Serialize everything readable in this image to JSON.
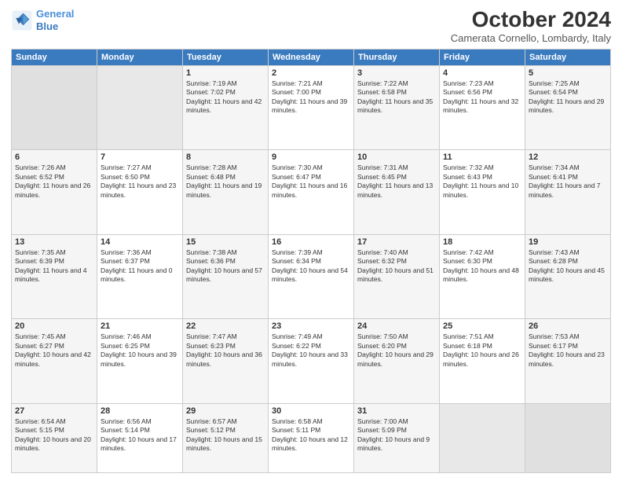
{
  "header": {
    "logo_line1": "General",
    "logo_line2": "Blue",
    "month_title": "October 2024",
    "location": "Camerata Cornello, Lombardy, Italy"
  },
  "weekdays": [
    "Sunday",
    "Monday",
    "Tuesday",
    "Wednesday",
    "Thursday",
    "Friday",
    "Saturday"
  ],
  "weeks": [
    [
      {
        "day": "",
        "empty": true
      },
      {
        "day": "",
        "empty": true
      },
      {
        "day": "1",
        "sunrise": "7:19 AM",
        "sunset": "7:02 PM",
        "daylight": "11 hours and 42 minutes."
      },
      {
        "day": "2",
        "sunrise": "7:21 AM",
        "sunset": "7:00 PM",
        "daylight": "11 hours and 39 minutes."
      },
      {
        "day": "3",
        "sunrise": "7:22 AM",
        "sunset": "6:58 PM",
        "daylight": "11 hours and 35 minutes."
      },
      {
        "day": "4",
        "sunrise": "7:23 AM",
        "sunset": "6:56 PM",
        "daylight": "11 hours and 32 minutes."
      },
      {
        "day": "5",
        "sunrise": "7:25 AM",
        "sunset": "6:54 PM",
        "daylight": "11 hours and 29 minutes."
      }
    ],
    [
      {
        "day": "6",
        "sunrise": "7:26 AM",
        "sunset": "6:52 PM",
        "daylight": "11 hours and 26 minutes."
      },
      {
        "day": "7",
        "sunrise": "7:27 AM",
        "sunset": "6:50 PM",
        "daylight": "11 hours and 23 minutes."
      },
      {
        "day": "8",
        "sunrise": "7:28 AM",
        "sunset": "6:48 PM",
        "daylight": "11 hours and 19 minutes."
      },
      {
        "day": "9",
        "sunrise": "7:30 AM",
        "sunset": "6:47 PM",
        "daylight": "11 hours and 16 minutes."
      },
      {
        "day": "10",
        "sunrise": "7:31 AM",
        "sunset": "6:45 PM",
        "daylight": "11 hours and 13 minutes."
      },
      {
        "day": "11",
        "sunrise": "7:32 AM",
        "sunset": "6:43 PM",
        "daylight": "11 hours and 10 minutes."
      },
      {
        "day": "12",
        "sunrise": "7:34 AM",
        "sunset": "6:41 PM",
        "daylight": "11 hours and 7 minutes."
      }
    ],
    [
      {
        "day": "13",
        "sunrise": "7:35 AM",
        "sunset": "6:39 PM",
        "daylight": "11 hours and 4 minutes."
      },
      {
        "day": "14",
        "sunrise": "7:36 AM",
        "sunset": "6:37 PM",
        "daylight": "11 hours and 0 minutes."
      },
      {
        "day": "15",
        "sunrise": "7:38 AM",
        "sunset": "6:36 PM",
        "daylight": "10 hours and 57 minutes."
      },
      {
        "day": "16",
        "sunrise": "7:39 AM",
        "sunset": "6:34 PM",
        "daylight": "10 hours and 54 minutes."
      },
      {
        "day": "17",
        "sunrise": "7:40 AM",
        "sunset": "6:32 PM",
        "daylight": "10 hours and 51 minutes."
      },
      {
        "day": "18",
        "sunrise": "7:42 AM",
        "sunset": "6:30 PM",
        "daylight": "10 hours and 48 minutes."
      },
      {
        "day": "19",
        "sunrise": "7:43 AM",
        "sunset": "6:28 PM",
        "daylight": "10 hours and 45 minutes."
      }
    ],
    [
      {
        "day": "20",
        "sunrise": "7:45 AM",
        "sunset": "6:27 PM",
        "daylight": "10 hours and 42 minutes."
      },
      {
        "day": "21",
        "sunrise": "7:46 AM",
        "sunset": "6:25 PM",
        "daylight": "10 hours and 39 minutes."
      },
      {
        "day": "22",
        "sunrise": "7:47 AM",
        "sunset": "6:23 PM",
        "daylight": "10 hours and 36 minutes."
      },
      {
        "day": "23",
        "sunrise": "7:49 AM",
        "sunset": "6:22 PM",
        "daylight": "10 hours and 33 minutes."
      },
      {
        "day": "24",
        "sunrise": "7:50 AM",
        "sunset": "6:20 PM",
        "daylight": "10 hours and 29 minutes."
      },
      {
        "day": "25",
        "sunrise": "7:51 AM",
        "sunset": "6:18 PM",
        "daylight": "10 hours and 26 minutes."
      },
      {
        "day": "26",
        "sunrise": "7:53 AM",
        "sunset": "6:17 PM",
        "daylight": "10 hours and 23 minutes."
      }
    ],
    [
      {
        "day": "27",
        "sunrise": "6:54 AM",
        "sunset": "5:15 PM",
        "daylight": "10 hours and 20 minutes."
      },
      {
        "day": "28",
        "sunrise": "6:56 AM",
        "sunset": "5:14 PM",
        "daylight": "10 hours and 17 minutes."
      },
      {
        "day": "29",
        "sunrise": "6:57 AM",
        "sunset": "5:12 PM",
        "daylight": "10 hours and 15 minutes."
      },
      {
        "day": "30",
        "sunrise": "6:58 AM",
        "sunset": "5:11 PM",
        "daylight": "10 hours and 12 minutes."
      },
      {
        "day": "31",
        "sunrise": "7:00 AM",
        "sunset": "5:09 PM",
        "daylight": "10 hours and 9 minutes."
      },
      {
        "day": "",
        "empty": true
      },
      {
        "day": "",
        "empty": true
      }
    ]
  ]
}
